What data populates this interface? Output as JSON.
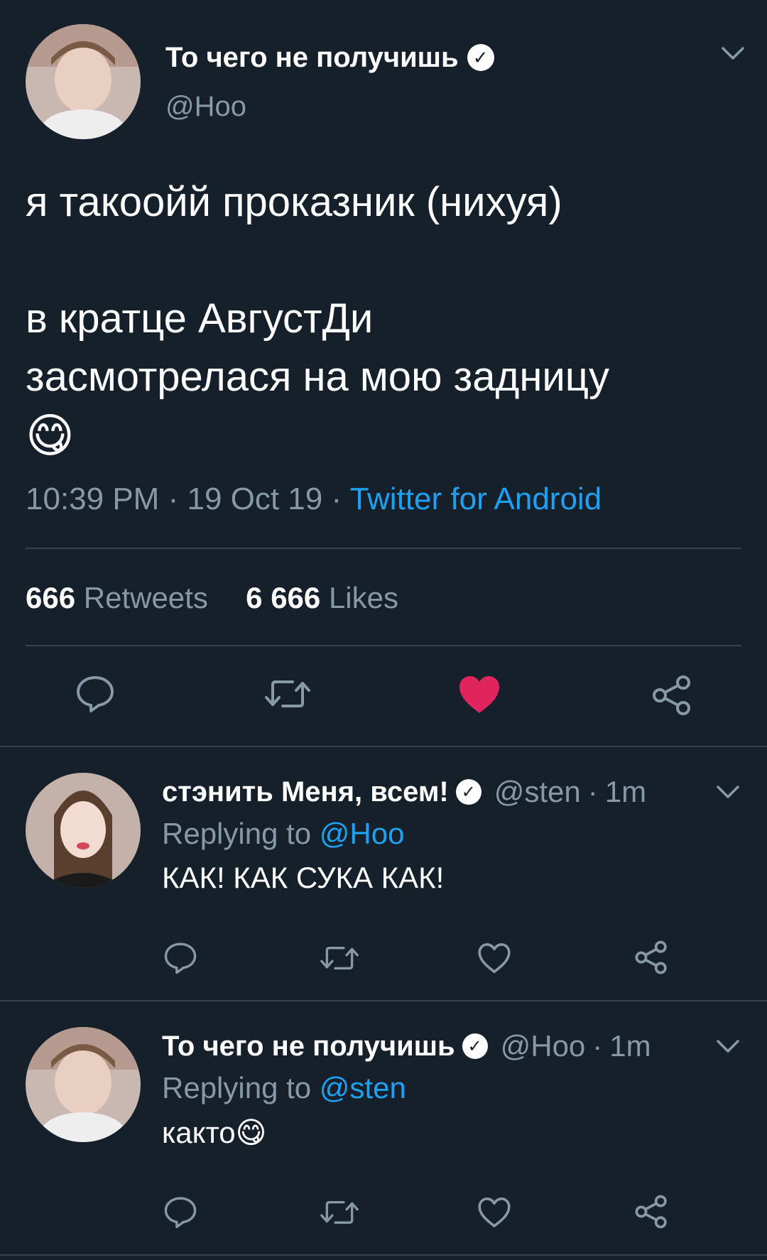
{
  "main_tweet": {
    "author_name": "То чего не получишь",
    "handle": "@Hoo",
    "text_line1": "я такоойй проказник (нихуя)",
    "text_line2": "в кратце АвгустДи",
    "text_line3": "засмотрелася на мою задницу",
    "emoji": "😋",
    "time": "10:39 PM",
    "date": "19 Oct 19",
    "sep": "·",
    "source": "Twitter for Android",
    "retweets_count": "666",
    "retweets_label": "Retweets",
    "likes_count": "6 666",
    "likes_label": "Likes",
    "liked": true
  },
  "replies": [
    {
      "author_name": "стэнить Меня, всем!",
      "handle": "@sten",
      "age": "1m",
      "sep": "·",
      "replying_label": "Replying to",
      "replying_to": "@Hoo",
      "text": "КАК! КАК СУКА КАК!",
      "emoji": ""
    },
    {
      "author_name": "То чего не получишь",
      "handle": "@Hoo",
      "age": "1m",
      "sep": "·",
      "replying_label": "Replying to",
      "replying_to": "@sten",
      "text": "както",
      "emoji": "😋"
    }
  ],
  "icons": {
    "verified": "verified-badge-icon",
    "reply": "reply-icon",
    "retweet": "retweet-icon",
    "like": "heart-icon",
    "share": "share-icon",
    "more": "chevron-down-icon"
  },
  "colors": {
    "background": "#15202b",
    "text": "#ffffff",
    "secondary": "#8899a6",
    "link": "#1da1f2",
    "like": "#e0245e",
    "divider": "#38444d"
  }
}
